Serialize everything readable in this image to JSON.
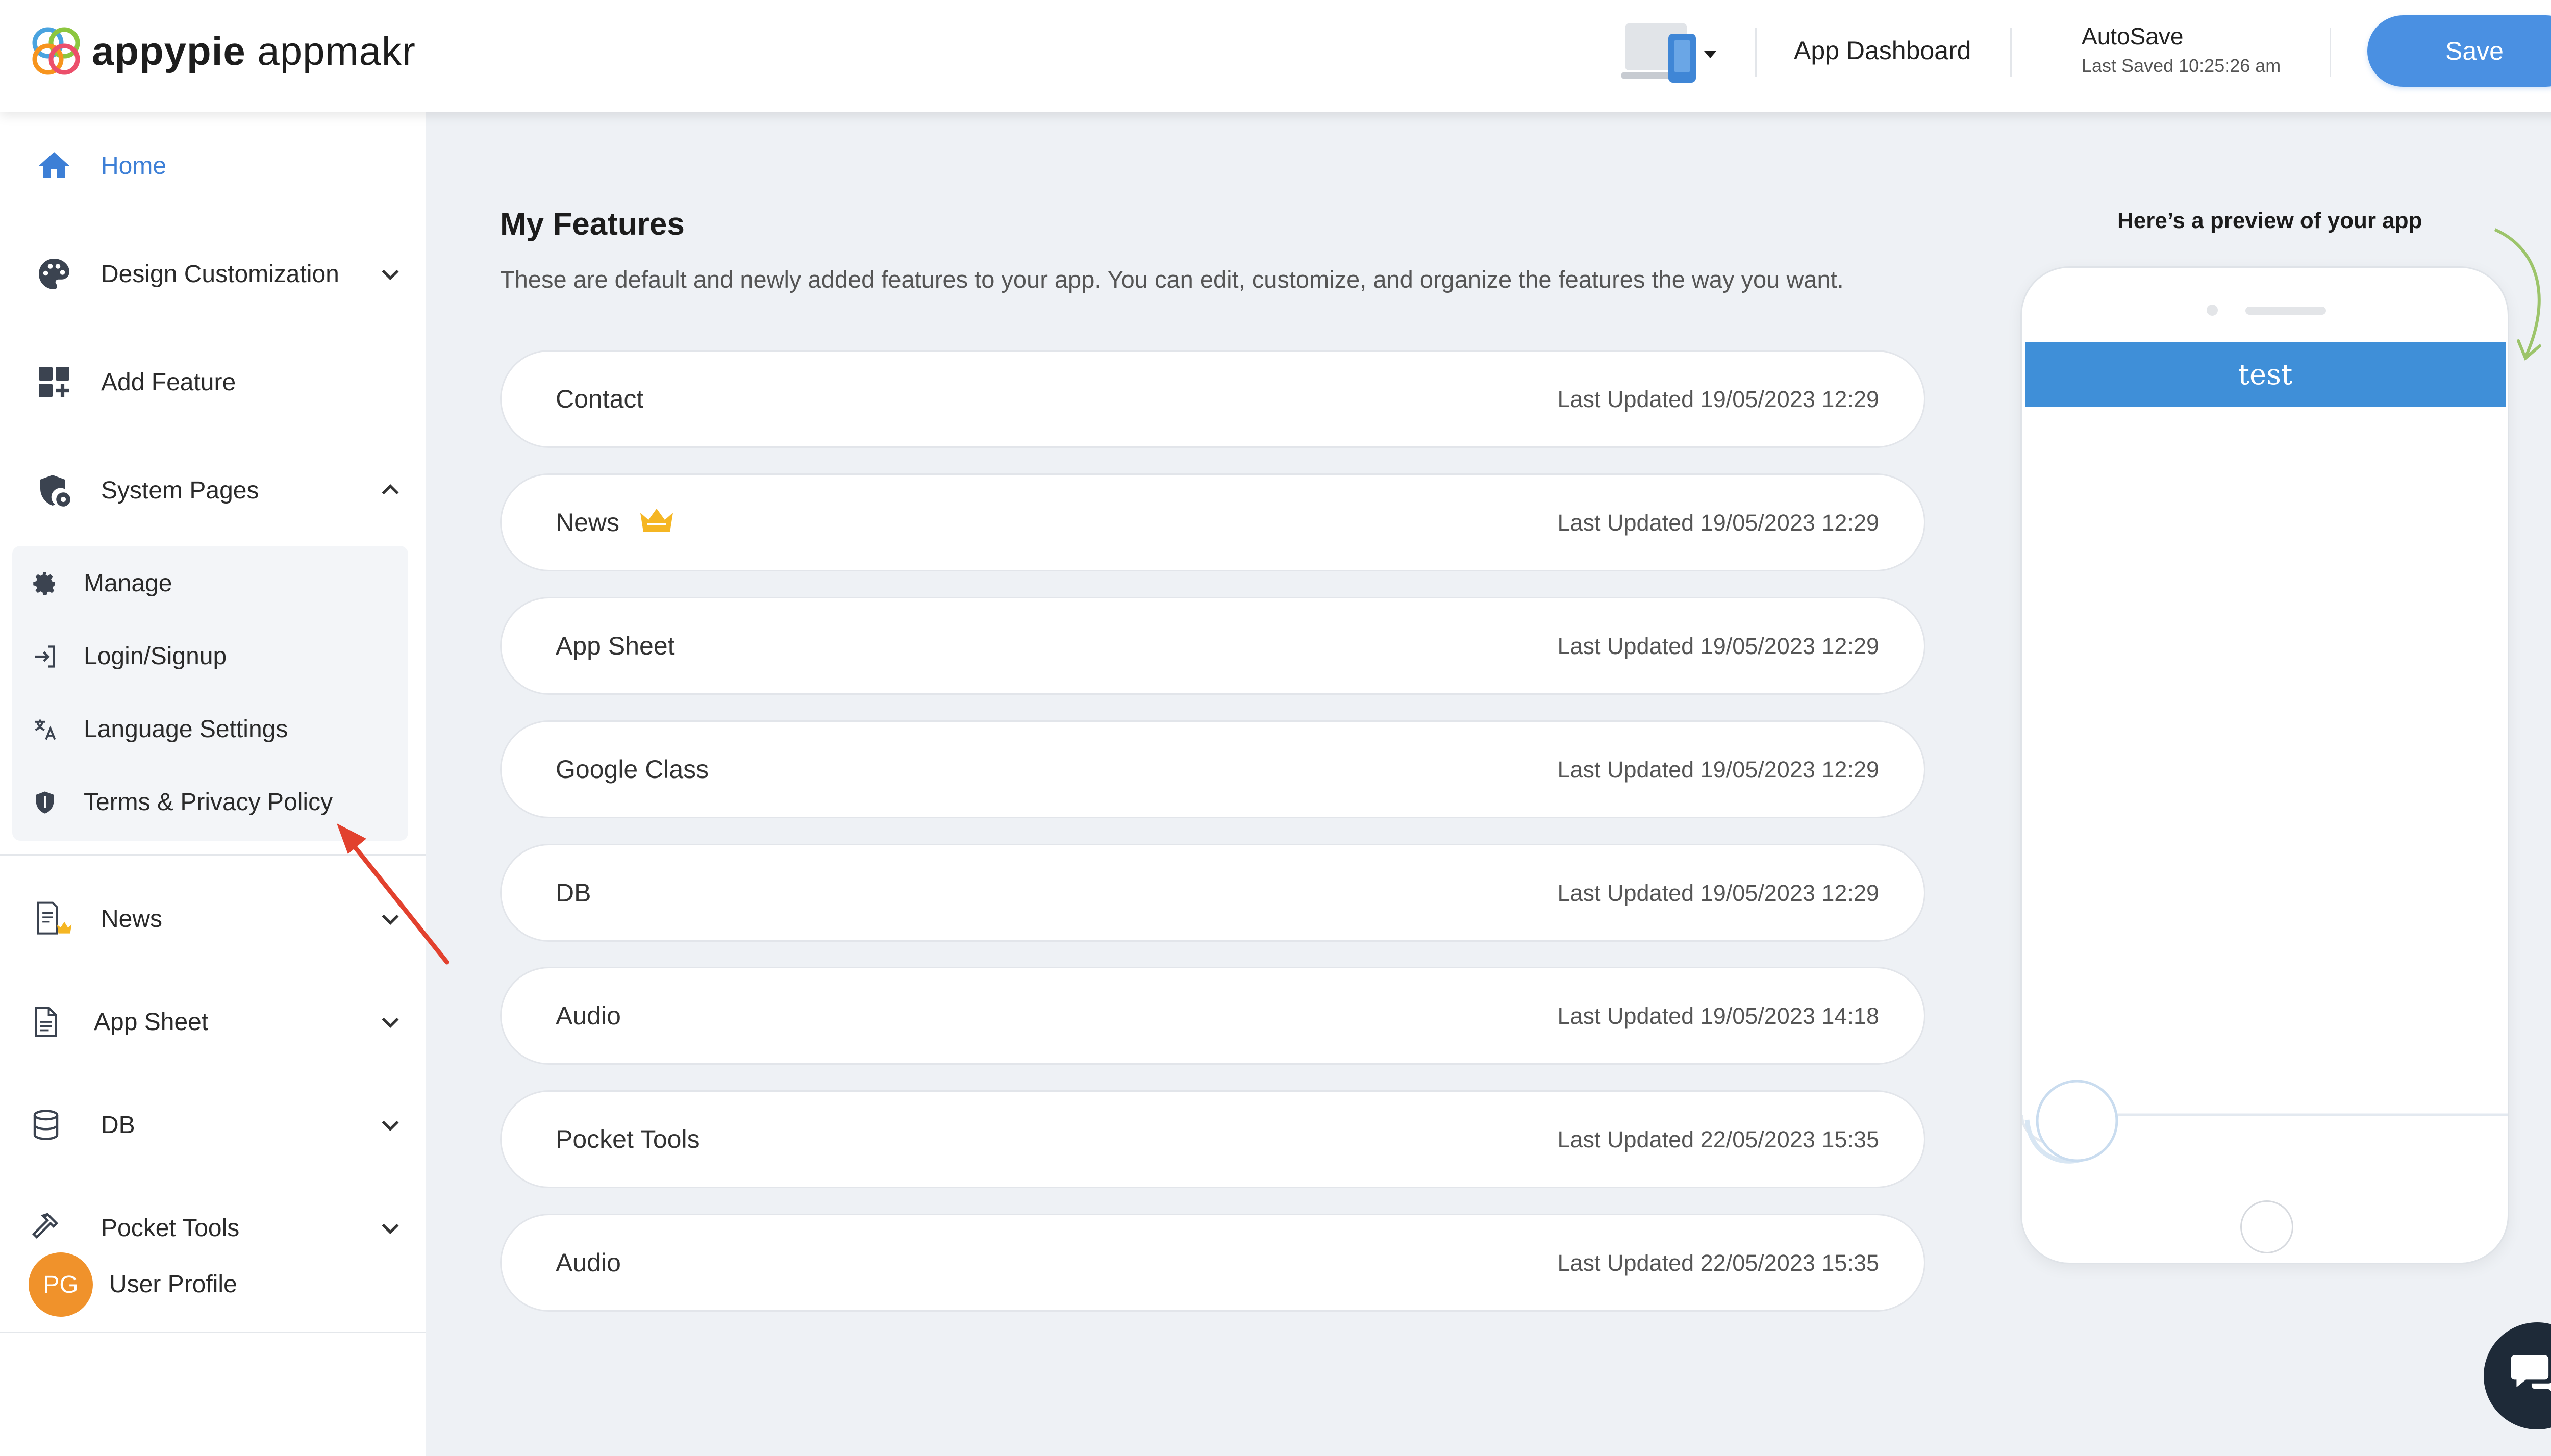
{
  "header": {
    "brand_primary": "appypie",
    "brand_secondary": "appmakr",
    "dashboard_label": "App Dashboard",
    "autosave_title": "AutoSave",
    "autosave_sub": "Last Saved 10:25:26 am",
    "save_label": "Save",
    "device_icon": "laptop-phone-icon"
  },
  "sidebar": {
    "home": "Home",
    "design": "Design Customization",
    "add_feature": "Add Feature",
    "system_pages": "System Pages",
    "sub": {
      "manage": "Manage",
      "login": "Login/Signup",
      "language": "Language Settings",
      "terms": "Terms & Privacy Policy"
    },
    "news": "News",
    "app_sheet": "App Sheet",
    "db": "DB",
    "pocket_tools": "Pocket Tools",
    "profile_initials": "PG",
    "profile_label": "User Profile"
  },
  "main": {
    "title": "My Features",
    "subtitle": "These are default and newly added features to your app. You can edit, customize, and organize the features the way you want.",
    "features": [
      {
        "name": "Contact",
        "updated": "Last Updated 19/05/2023 12:29",
        "premium": false
      },
      {
        "name": "News",
        "updated": "Last Updated 19/05/2023 12:29",
        "premium": true
      },
      {
        "name": "App Sheet",
        "updated": "Last Updated 19/05/2023 12:29",
        "premium": false
      },
      {
        "name": "Google Class",
        "updated": "Last Updated 19/05/2023 12:29",
        "premium": false
      },
      {
        "name": "DB",
        "updated": "Last Updated 19/05/2023 12:29",
        "premium": false
      },
      {
        "name": "Audio",
        "updated": "Last Updated 19/05/2023 14:18",
        "premium": false
      },
      {
        "name": "Pocket Tools",
        "updated": "Last Updated 22/05/2023 15:35",
        "premium": false
      },
      {
        "name": "Audio",
        "updated": "Last Updated 22/05/2023 15:35",
        "premium": false
      }
    ]
  },
  "preview": {
    "label": "Here’s a preview of your app",
    "app_title": "test"
  },
  "colors": {
    "accent": "#4a90e2",
    "active_nav": "#3d7fd6",
    "phone_bar": "#3f8fd8",
    "avatar": "#f0922b",
    "crown": "#f5b623",
    "annotation_arrow": "#e2412e",
    "chat": "#1e2a38"
  }
}
